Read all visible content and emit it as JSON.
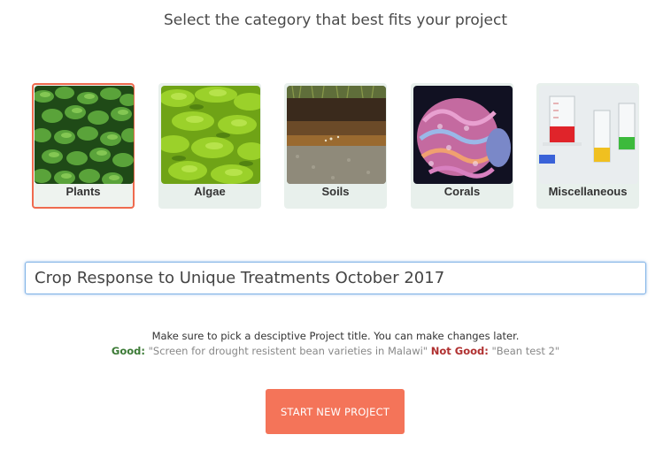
{
  "heading": "Select the category that best fits your project",
  "categories": [
    {
      "label": "Plants",
      "selected": true
    },
    {
      "label": "Algae",
      "selected": false
    },
    {
      "label": "Soils",
      "selected": false
    },
    {
      "label": "Corals",
      "selected": false
    },
    {
      "label": "Miscellaneous",
      "selected": false
    }
  ],
  "title_input": {
    "value": "Crop Response to Unique Treatments October 2017"
  },
  "help": {
    "line1": "Make sure to pick a desciptive Project title. You can make changes later.",
    "good_label": "Good:",
    "good_example": "\"Screen for drought resistent bean varieties in Malawi\"",
    "bad_label": "Not Good:",
    "bad_example": "\"Bean test 2\""
  },
  "start_button": {
    "label": "START NEW PROJECT"
  },
  "colors": {
    "accent": "#f47459",
    "selected_border": "#ef6a4e",
    "good": "#3b7a35",
    "not_good": "#b03030"
  }
}
